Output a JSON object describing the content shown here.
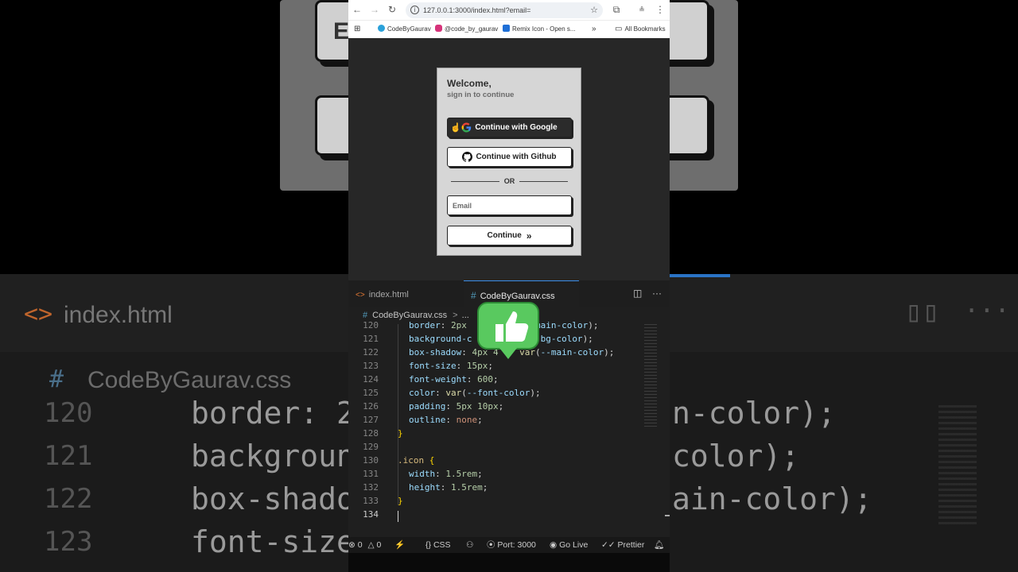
{
  "browser": {
    "url": "127.0.0.1:3000/index.html?email=",
    "bookmarks": [
      "CodeByGaurav",
      "@code_by_gaurav",
      "Remix Icon - Open s...",
      "All Bookmarks"
    ]
  },
  "login": {
    "welcome": "Welcome,",
    "subtitle": "sign in to continue",
    "google_label": "Continue with Google",
    "github_label": "Continue with Github",
    "divider": "OR",
    "email_placeholder": "Email",
    "continue_label": "Continue"
  },
  "editor": {
    "tabs": [
      "index.html",
      "CodeByGaurav.css"
    ],
    "breadcrumb": "CodeByGaurav.css",
    "breadcrumb_more": "...",
    "line_numbers": [
      "120",
      "121",
      "122",
      "123",
      "124",
      "125",
      "126",
      "127",
      "128",
      "129",
      "130",
      "131",
      "132",
      "133",
      "134"
    ]
  },
  "statusbar": {
    "errors": "0",
    "warnings": "0",
    "language": "CSS",
    "port": "Port: 3000",
    "golive": "Go Live",
    "prettier": "Prettier"
  },
  "background": {
    "tab_label": "index.html",
    "crumb_label": "CodeByGaurav.css",
    "line_numbers": [
      "120",
      "121",
      "122",
      "123"
    ],
    "code_fragments": [
      "border: 2",
      "backgroun",
      "box-shado",
      "font-size"
    ],
    "right_fragments": [
      "n-color);",
      "color);",
      "ain-color);"
    ]
  },
  "colors": {
    "accent_blue": "#3b8eea",
    "emoji_green": "#3bb54a"
  }
}
